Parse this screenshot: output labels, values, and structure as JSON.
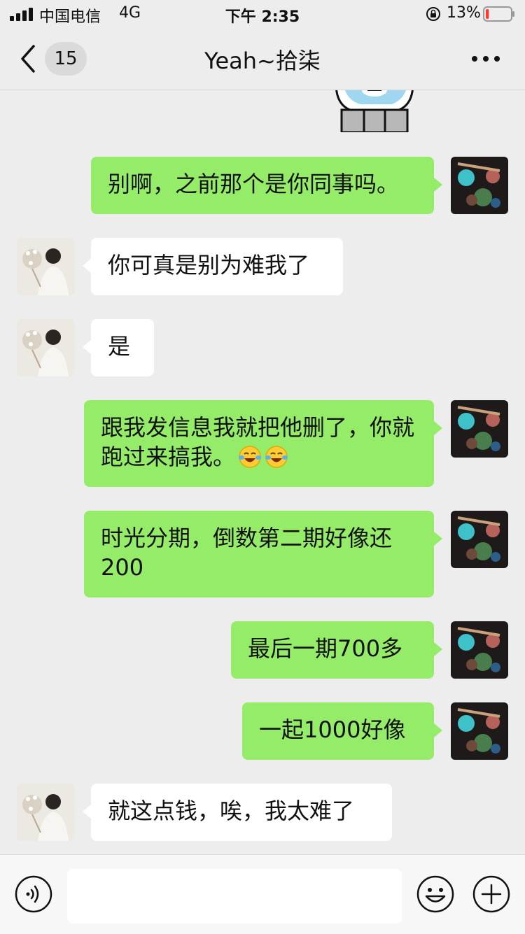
{
  "status_bar": {
    "carrier": "中国电信",
    "network": "4G",
    "time": "下午 2:35",
    "battery_percent": "13%",
    "battery_level": 0.13,
    "battery_color": "#ff3b30"
  },
  "nav": {
    "unread_count": "15",
    "title": "Yeah~拾柒"
  },
  "colors": {
    "outgoing_bubble": "#95ec69",
    "incoming_bubble": "#ffffff",
    "background": "#ededed"
  },
  "messages": [
    {
      "direction": "out",
      "text": "别啊，之前那个是你同事吗。"
    },
    {
      "direction": "in",
      "text": "你可真是别为难我了"
    },
    {
      "direction": "in",
      "text": "是"
    },
    {
      "direction": "out",
      "text": "跟我发信息我就把他删了，你就跑过来搞我。",
      "emojis": [
        "face-with-tears-of-joy",
        "face-with-tears-of-joy"
      ]
    },
    {
      "direction": "out",
      "text": "时光分期，倒数第二期好像还200"
    },
    {
      "direction": "out",
      "text": "最后一期700多"
    },
    {
      "direction": "out",
      "text": "一起1000好像"
    },
    {
      "direction": "in",
      "text": "就这点钱，唉，我太难了"
    }
  ],
  "input_bar": {
    "icons": [
      "voice-icon",
      "emoji-icon",
      "plus-icon"
    ],
    "value": ""
  }
}
